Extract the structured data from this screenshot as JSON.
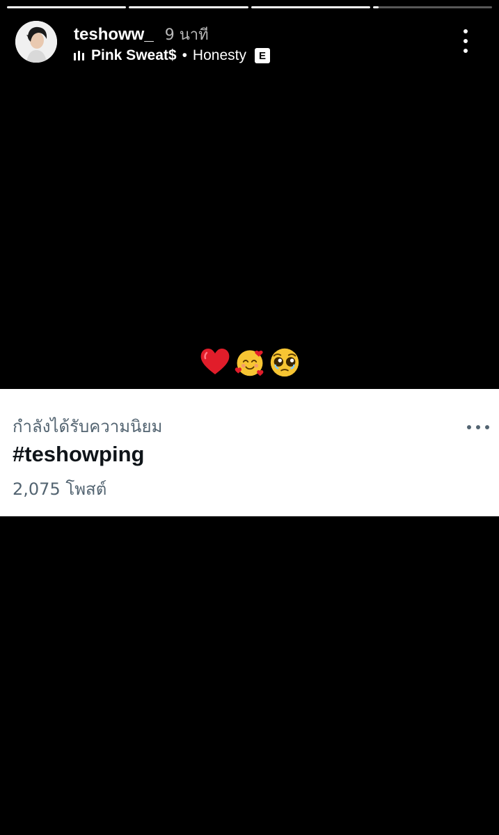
{
  "story": {
    "progress_segments": [
      1,
      1,
      1,
      0.05
    ],
    "username": "teshoww_",
    "time_ago": "9 นาที",
    "music": {
      "icon": "equalizer-bars-icon",
      "artist": "Pink Sweat$",
      "separator": "•",
      "song": "Honesty",
      "explicit_badge": "E"
    },
    "more_icon": "vertical-ellipsis-icon",
    "emojis": [
      "red-heart-icon",
      "smiling-face-with-hearts-icon",
      "pleading-face-icon"
    ]
  },
  "trend_card": {
    "context": "กำลังได้รับความนิยม",
    "title": "#teshowping",
    "post_count": "2,075 โพสต์",
    "more_icon": "horizontal-ellipsis-icon"
  },
  "colors": {
    "background": "#000000",
    "card_background": "#ffffff",
    "card_secondary_text": "#536471",
    "card_primary_text": "#0f1419"
  }
}
